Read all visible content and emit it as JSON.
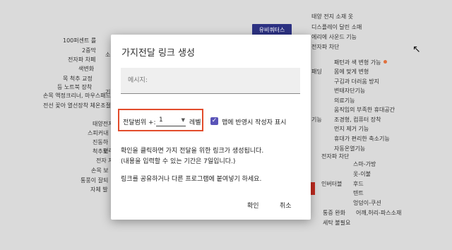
{
  "background": {
    "topic_pill": "유비쿼터스",
    "nodes_left": [
      "100퍼센트 를",
      "2중막",
      "전자파 차폐",
      "색변화",
      "목 척추 교정",
      "등 노트북 장착",
      "손목 액정크리너, 마우스패드",
      "전선 꽂아 열선장착 체온조절",
      "태양전지",
      "스피커내",
      "진동하",
      "척추보",
      "전자 자",
      "손목 보",
      "통풍이 잘되",
      "자체 발"
    ],
    "nodes_right": [
      "태양 전지 소재 옷",
      "디스플레이 달린 소매",
      "에리에 사운드 기능",
      "전자파 차단",
      "패턴과 색 변형 가능",
      "몸에 맞게 변형",
      "구김과 더러움 방지",
      "변태자단기능",
      "의료기능",
      "움직임의 부족한 휴대공간",
      "조경형, 컴퓨터 장착",
      "먼지 제거 기능",
      "휴대가 편리한 축소기능",
      "자동온열기능",
      "전자파 차단",
      "스마-가방",
      "옷-이불",
      "후드",
      "텐트",
      "엉덩이-쿠션",
      "어깨,허리-파스소재",
      "통증 완화",
      "세탁 불필요",
      "인버터블",
      "기능",
      "패딩",
      "소",
      "기",
      "편리"
    ],
    "colors": {
      "pill": "#2d3283",
      "accent_red": "#c22b20",
      "dot": "#e0703d"
    }
  },
  "dialog": {
    "title": "가지전달 링크 생성",
    "message_placeholder": "메시지:",
    "range_label": "전달범위 +:",
    "range_value": "1",
    "level_label": "레벨",
    "checkbox_checked": true,
    "checkbox_label": "맵에 반영시 작성자 표시",
    "info_line1": "확인을 클릭하면 가지 전달을 위한 링크가 생성됩니다.",
    "info_line2": "(내용을 입력할 수 있는 기간은 7일입니다.)",
    "info_line3": "링크를 공유하거나 다른 프로그램에 붙여넣기 하세요.",
    "ok_label": "확인",
    "cancel_label": "취소",
    "colors": {
      "highlight_border": "#e24c2c",
      "checkbox": "#5a54b8"
    }
  }
}
